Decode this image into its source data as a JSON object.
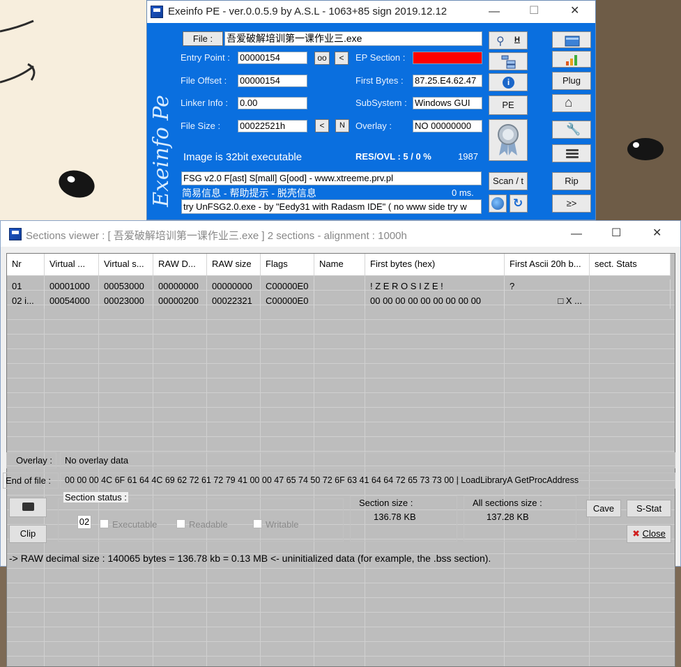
{
  "exeinfo": {
    "title": "Exeinfo PE - ver.0.0.5.9  by A.S.L -  1063+85 sign  2019.12.12",
    "file_label": "File :",
    "file_value": "吾爱破解培训第一课作业三.exe",
    "entry_point_label": "Entry Point :",
    "entry_point_value": "00000154",
    "oo_label": "oo",
    "lt_label": "<",
    "ep_section_label": "EP Section :",
    "file_offset_label": "File Offset :",
    "file_offset_value": "00000154",
    "first_bytes_label": "First Bytes :",
    "first_bytes_value": "87.25.E4.62.47",
    "linker_info_label": "Linker Info :",
    "linker_info_value": "0.00",
    "subsystem_label": "SubSystem :",
    "subsystem_value": "Windows GUI",
    "file_size_label": "File Size :",
    "file_size_value": "00022521h",
    "n_label": "N",
    "overlay_label": "Overlay :",
    "overlay_value": "NO  00000000",
    "image_info": "Image is 32bit executable",
    "res_ovl": "RES/OVL : 5 / 0 %",
    "year": "1987",
    "detect_line": "FSG v2.0  F[ast] S[mall] G[ood]  - www.xtreeme.prv.pl",
    "info_line": "简易信息 - 帮助提示 - 脱壳信息",
    "time": "0 ms.",
    "hint_line": "try UnFSG2.0.exe - by \"Eedy31 with Radasm IDE\" ( no www side try w",
    "h_label": "H",
    "pe_label": "PE",
    "scan_label": "Scan / t",
    "plug_label": "Plug",
    "rip_label": "Rip",
    "next_label": "≥>",
    "ep_color": "#ff0000"
  },
  "sections_viewer": {
    "title": "Sections viewer :  [ 吾爱破解培训第一课作业三.exe ] 2 sections - alignment : 1000h",
    "columns": [
      "Nr",
      "Virtual ...",
      "Virtual s...",
      "RAW D...",
      "RAW size",
      "Flags",
      "Name",
      "First bytes (hex)",
      "First Ascii 20h b...",
      "sect. Stats"
    ],
    "rows": [
      [
        "01",
        "00001000",
        "00053000",
        "00000000",
        "00000000",
        "C00000E0",
        "",
        "  ! Z E R O   S I Z E !",
        "?",
        ""
      ],
      [
        "02 i...",
        "00054000",
        "00023000",
        "00000200",
        "00022321",
        "C00000E0",
        "",
        "00 00 00 00 00 00 00 00 00",
        "□  X ...",
        ""
      ]
    ],
    "overlay_label": "Overlay :",
    "overlay_value": "No overlay data",
    "eof_label": "End of file :",
    "eof_value": "00 00 00 4C 6F 61 64 4C 69 62 72 61 72 79 41 00 00 47 65 74 50 72 6F 63 41 64 64 72 65 73 73 00    |    LoadLibraryA  GetProcAddress",
    "clip_label": "Clip",
    "section_status_label": "Section status :",
    "section_number": "02",
    "executable_label": "Executable",
    "readable_label": "Readable",
    "writable_label": "Writable",
    "section_size_label": "Section size :",
    "section_size_value": "136.78 KB",
    "all_sections_size_label": "All sections size :",
    "all_sections_size_value": "137.28 KB",
    "cave_label": "Cave",
    "sstat_label": "S-Stat",
    "close_label": "Close",
    "status_line": "->  RAW decimal size :      140065 bytes  =  136.78 kb  = 0.13 MB <- uninitialized data (for example, the .bss section)."
  }
}
